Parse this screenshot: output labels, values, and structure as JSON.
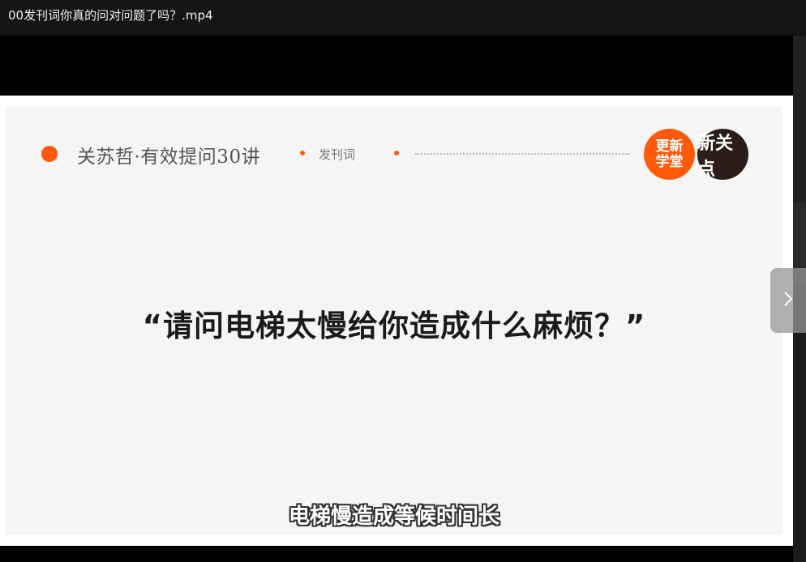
{
  "window": {
    "title": "00发刊词你真的问对问题了吗？.mp4"
  },
  "slide": {
    "series_title": "关苏哲·有效提问30讲",
    "section_label": "发刊词",
    "logo_left_line1": "更新",
    "logo_left_line2": "学堂",
    "logo_right": "新关点",
    "quote": "“请问电梯太慢给你造成什么麻烦？”",
    "subtitle": "电梯慢造成等候时间长"
  },
  "controls": {
    "next_icon": "chevron-right-icon"
  },
  "colors": {
    "accent": "#ff5a0a",
    "logo_dark": "#2a1d1a",
    "slide_bg": "#f5f5f5",
    "titlebar_bg": "#151515"
  }
}
